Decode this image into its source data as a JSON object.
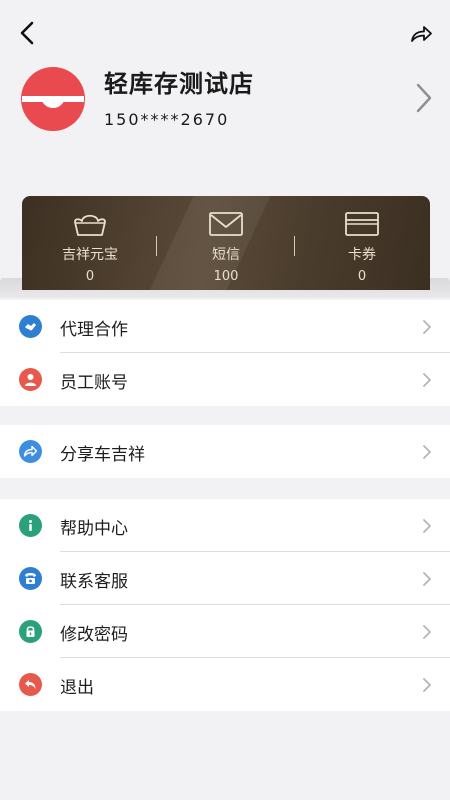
{
  "profile": {
    "store_name": "轻库存测试店",
    "phone": "150****2670"
  },
  "wallet": [
    {
      "label": "吉祥元宝",
      "value": "0",
      "icon": "ingot-icon"
    },
    {
      "label": "短信",
      "value": "100",
      "icon": "envelope-icon"
    },
    {
      "label": "卡券",
      "value": "0",
      "icon": "card-icon"
    }
  ],
  "menu": {
    "group1": [
      {
        "label": "代理合作",
        "icon": "handshake-icon",
        "color": "#2f7fd1"
      },
      {
        "label": "员工账号",
        "icon": "person-icon",
        "color": "#e8594d"
      }
    ],
    "group2": [
      {
        "label": "分享车吉祥",
        "icon": "share-icon",
        "color": "#3d8ee0"
      }
    ],
    "group3": [
      {
        "label": "帮助中心",
        "icon": "info-icon",
        "color": "#2aa07c"
      },
      {
        "label": "联系客服",
        "icon": "phone-icon",
        "color": "#2f7fd1"
      },
      {
        "label": "修改密码",
        "icon": "lock-icon",
        "color": "#2aa07c"
      },
      {
        "label": "退出",
        "icon": "logout-icon",
        "color": "#e8594d"
      }
    ]
  },
  "colors": {
    "brand_red": "#e94a4f",
    "card_dark": "#4a3c2c",
    "card_text": "#e9dfcf",
    "page_bg": "#f2f2f4"
  }
}
